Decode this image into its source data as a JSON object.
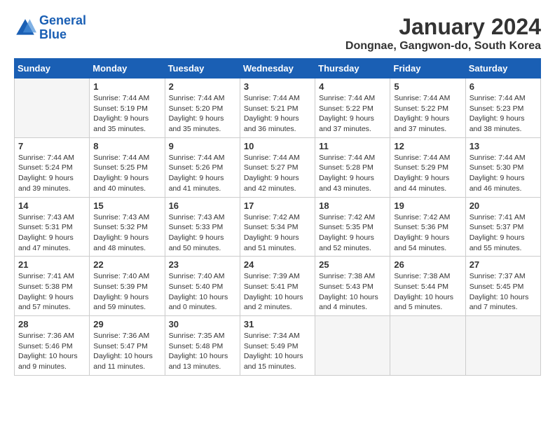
{
  "logo": {
    "text_general": "General",
    "text_blue": "Blue"
  },
  "title": {
    "month_year": "January 2024",
    "location": "Dongnae, Gangwon-do, South Korea"
  },
  "days_of_week": [
    "Sunday",
    "Monday",
    "Tuesday",
    "Wednesday",
    "Thursday",
    "Friday",
    "Saturday"
  ],
  "weeks": [
    [
      {
        "day": "",
        "empty": true
      },
      {
        "day": "1",
        "sunrise": "Sunrise: 7:44 AM",
        "sunset": "Sunset: 5:19 PM",
        "daylight": "Daylight: 9 hours and 35 minutes."
      },
      {
        "day": "2",
        "sunrise": "Sunrise: 7:44 AM",
        "sunset": "Sunset: 5:20 PM",
        "daylight": "Daylight: 9 hours and 35 minutes."
      },
      {
        "day": "3",
        "sunrise": "Sunrise: 7:44 AM",
        "sunset": "Sunset: 5:21 PM",
        "daylight": "Daylight: 9 hours and 36 minutes."
      },
      {
        "day": "4",
        "sunrise": "Sunrise: 7:44 AM",
        "sunset": "Sunset: 5:22 PM",
        "daylight": "Daylight: 9 hours and 37 minutes."
      },
      {
        "day": "5",
        "sunrise": "Sunrise: 7:44 AM",
        "sunset": "Sunset: 5:22 PM",
        "daylight": "Daylight: 9 hours and 37 minutes."
      },
      {
        "day": "6",
        "sunrise": "Sunrise: 7:44 AM",
        "sunset": "Sunset: 5:23 PM",
        "daylight": "Daylight: 9 hours and 38 minutes."
      }
    ],
    [
      {
        "day": "7",
        "sunrise": "Sunrise: 7:44 AM",
        "sunset": "Sunset: 5:24 PM",
        "daylight": "Daylight: 9 hours and 39 minutes."
      },
      {
        "day": "8",
        "sunrise": "Sunrise: 7:44 AM",
        "sunset": "Sunset: 5:25 PM",
        "daylight": "Daylight: 9 hours and 40 minutes."
      },
      {
        "day": "9",
        "sunrise": "Sunrise: 7:44 AM",
        "sunset": "Sunset: 5:26 PM",
        "daylight": "Daylight: 9 hours and 41 minutes."
      },
      {
        "day": "10",
        "sunrise": "Sunrise: 7:44 AM",
        "sunset": "Sunset: 5:27 PM",
        "daylight": "Daylight: 9 hours and 42 minutes."
      },
      {
        "day": "11",
        "sunrise": "Sunrise: 7:44 AM",
        "sunset": "Sunset: 5:28 PM",
        "daylight": "Daylight: 9 hours and 43 minutes."
      },
      {
        "day": "12",
        "sunrise": "Sunrise: 7:44 AM",
        "sunset": "Sunset: 5:29 PM",
        "daylight": "Daylight: 9 hours and 44 minutes."
      },
      {
        "day": "13",
        "sunrise": "Sunrise: 7:44 AM",
        "sunset": "Sunset: 5:30 PM",
        "daylight": "Daylight: 9 hours and 46 minutes."
      }
    ],
    [
      {
        "day": "14",
        "sunrise": "Sunrise: 7:43 AM",
        "sunset": "Sunset: 5:31 PM",
        "daylight": "Daylight: 9 hours and 47 minutes."
      },
      {
        "day": "15",
        "sunrise": "Sunrise: 7:43 AM",
        "sunset": "Sunset: 5:32 PM",
        "daylight": "Daylight: 9 hours and 48 minutes."
      },
      {
        "day": "16",
        "sunrise": "Sunrise: 7:43 AM",
        "sunset": "Sunset: 5:33 PM",
        "daylight": "Daylight: 9 hours and 50 minutes."
      },
      {
        "day": "17",
        "sunrise": "Sunrise: 7:42 AM",
        "sunset": "Sunset: 5:34 PM",
        "daylight": "Daylight: 9 hours and 51 minutes."
      },
      {
        "day": "18",
        "sunrise": "Sunrise: 7:42 AM",
        "sunset": "Sunset: 5:35 PM",
        "daylight": "Daylight: 9 hours and 52 minutes."
      },
      {
        "day": "19",
        "sunrise": "Sunrise: 7:42 AM",
        "sunset": "Sunset: 5:36 PM",
        "daylight": "Daylight: 9 hours and 54 minutes."
      },
      {
        "day": "20",
        "sunrise": "Sunrise: 7:41 AM",
        "sunset": "Sunset: 5:37 PM",
        "daylight": "Daylight: 9 hours and 55 minutes."
      }
    ],
    [
      {
        "day": "21",
        "sunrise": "Sunrise: 7:41 AM",
        "sunset": "Sunset: 5:38 PM",
        "daylight": "Daylight: 9 hours and 57 minutes."
      },
      {
        "day": "22",
        "sunrise": "Sunrise: 7:40 AM",
        "sunset": "Sunset: 5:39 PM",
        "daylight": "Daylight: 9 hours and 59 minutes."
      },
      {
        "day": "23",
        "sunrise": "Sunrise: 7:40 AM",
        "sunset": "Sunset: 5:40 PM",
        "daylight": "Daylight: 10 hours and 0 minutes."
      },
      {
        "day": "24",
        "sunrise": "Sunrise: 7:39 AM",
        "sunset": "Sunset: 5:41 PM",
        "daylight": "Daylight: 10 hours and 2 minutes."
      },
      {
        "day": "25",
        "sunrise": "Sunrise: 7:38 AM",
        "sunset": "Sunset: 5:43 PM",
        "daylight": "Daylight: 10 hours and 4 minutes."
      },
      {
        "day": "26",
        "sunrise": "Sunrise: 7:38 AM",
        "sunset": "Sunset: 5:44 PM",
        "daylight": "Daylight: 10 hours and 5 minutes."
      },
      {
        "day": "27",
        "sunrise": "Sunrise: 7:37 AM",
        "sunset": "Sunset: 5:45 PM",
        "daylight": "Daylight: 10 hours and 7 minutes."
      }
    ],
    [
      {
        "day": "28",
        "sunrise": "Sunrise: 7:36 AM",
        "sunset": "Sunset: 5:46 PM",
        "daylight": "Daylight: 10 hours and 9 minutes."
      },
      {
        "day": "29",
        "sunrise": "Sunrise: 7:36 AM",
        "sunset": "Sunset: 5:47 PM",
        "daylight": "Daylight: 10 hours and 11 minutes."
      },
      {
        "day": "30",
        "sunrise": "Sunrise: 7:35 AM",
        "sunset": "Sunset: 5:48 PM",
        "daylight": "Daylight: 10 hours and 13 minutes."
      },
      {
        "day": "31",
        "sunrise": "Sunrise: 7:34 AM",
        "sunset": "Sunset: 5:49 PM",
        "daylight": "Daylight: 10 hours and 15 minutes."
      },
      {
        "day": "",
        "empty": true
      },
      {
        "day": "",
        "empty": true
      },
      {
        "day": "",
        "empty": true
      }
    ]
  ]
}
